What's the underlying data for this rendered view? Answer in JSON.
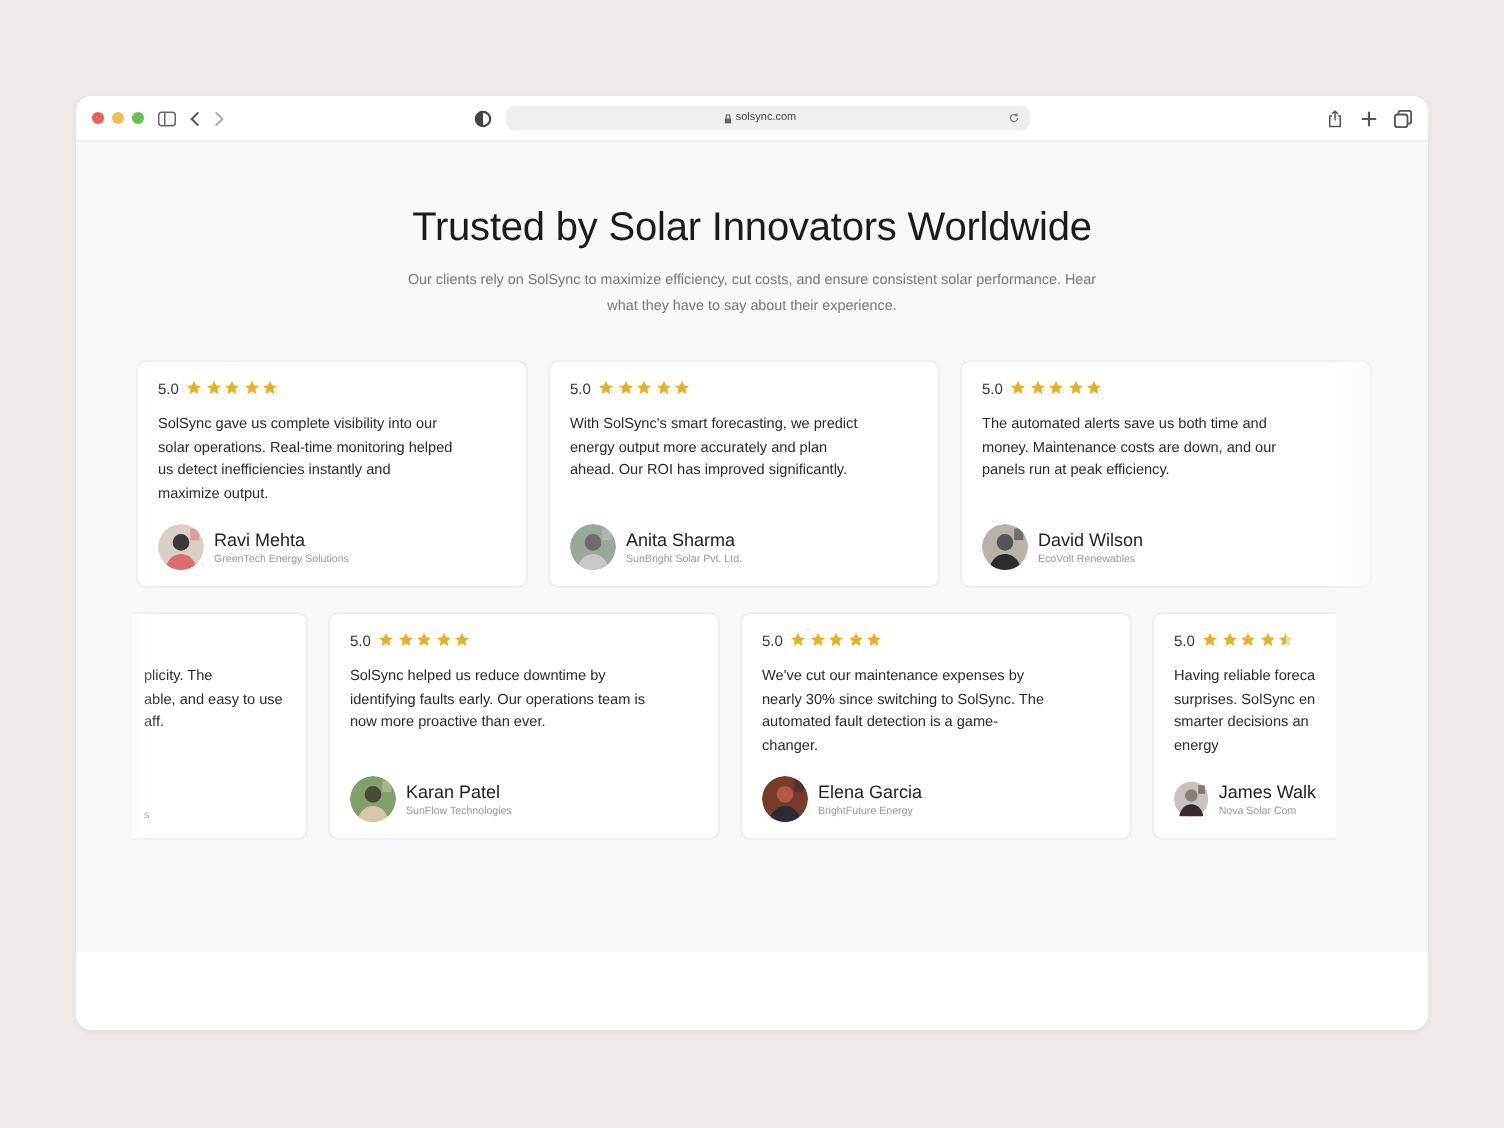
{
  "browser": {
    "url": "solsync.com"
  },
  "heading": "Trusted by Solar Innovators Worldwide",
  "subtitle": "Our clients rely on SolSync to maximize efficiency, cut costs, and ensure consistent solar performance. Hear what they have to say about their experience.",
  "rows": [
    {
      "testimonials": [
        {
          "kind": "full",
          "rating": "5.0",
          "stars": 5,
          "lines": [
            "SolSync gave us complete visibility into our",
            "solar operations. Real-time monitoring helped",
            "us detect inefficiencies instantly and",
            "maximize output."
          ],
          "name": "Ravi Mehta",
          "company": "GreenTech Energy Solutions"
        },
        {
          "kind": "full",
          "rating": "5.0",
          "stars": 5,
          "lines": [
            "With SolSync's smart forecasting, we predict",
            "energy output more accurately and plan",
            "ahead. Our ROI has improved significantly."
          ],
          "name": "Anita Sharma",
          "company": "SunBright Solar Pvt. Ltd."
        },
        {
          "kind": "full",
          "rating": "5.0",
          "stars": 5,
          "lines": [
            "The automated alerts save us both time and",
            "money. Maintenance costs are down, and our",
            "panels run at peak efficiency."
          ],
          "name": "David Wilson",
          "company": "EcoVolt Renewables"
        }
      ]
    },
    {
      "testimonials": [
        {
          "kind": "cut-left",
          "lines": [
            "plicity. The",
            "able, and easy to use",
            "aff."
          ],
          "company": "s"
        },
        {
          "kind": "full",
          "rating": "5.0",
          "stars": 5,
          "lines": [
            "SolSync helped us reduce downtime by",
            "identifying faults early. Our operations team is",
            "now more proactive than ever."
          ],
          "name": "Karan Patel",
          "company": "SunFlow Technologies"
        },
        {
          "kind": "full",
          "rating": "5.0",
          "stars": 5,
          "lines": [
            "We've cut our maintenance expenses by",
            "nearly 30% since switching to SolSync. The",
            "automated fault detection is a game-",
            "changer."
          ],
          "name": "Elena Garcia",
          "company": "BrightFuture Energy"
        },
        {
          "kind": "cut-right",
          "rating": "5.0",
          "stars": 4.5,
          "lines": [
            "Having reliable foreca",
            "surprises. SolSync en",
            "smarter decisions an",
            "energy"
          ],
          "name": "James Walk",
          "company": "Nova Solar Com"
        }
      ]
    }
  ]
}
